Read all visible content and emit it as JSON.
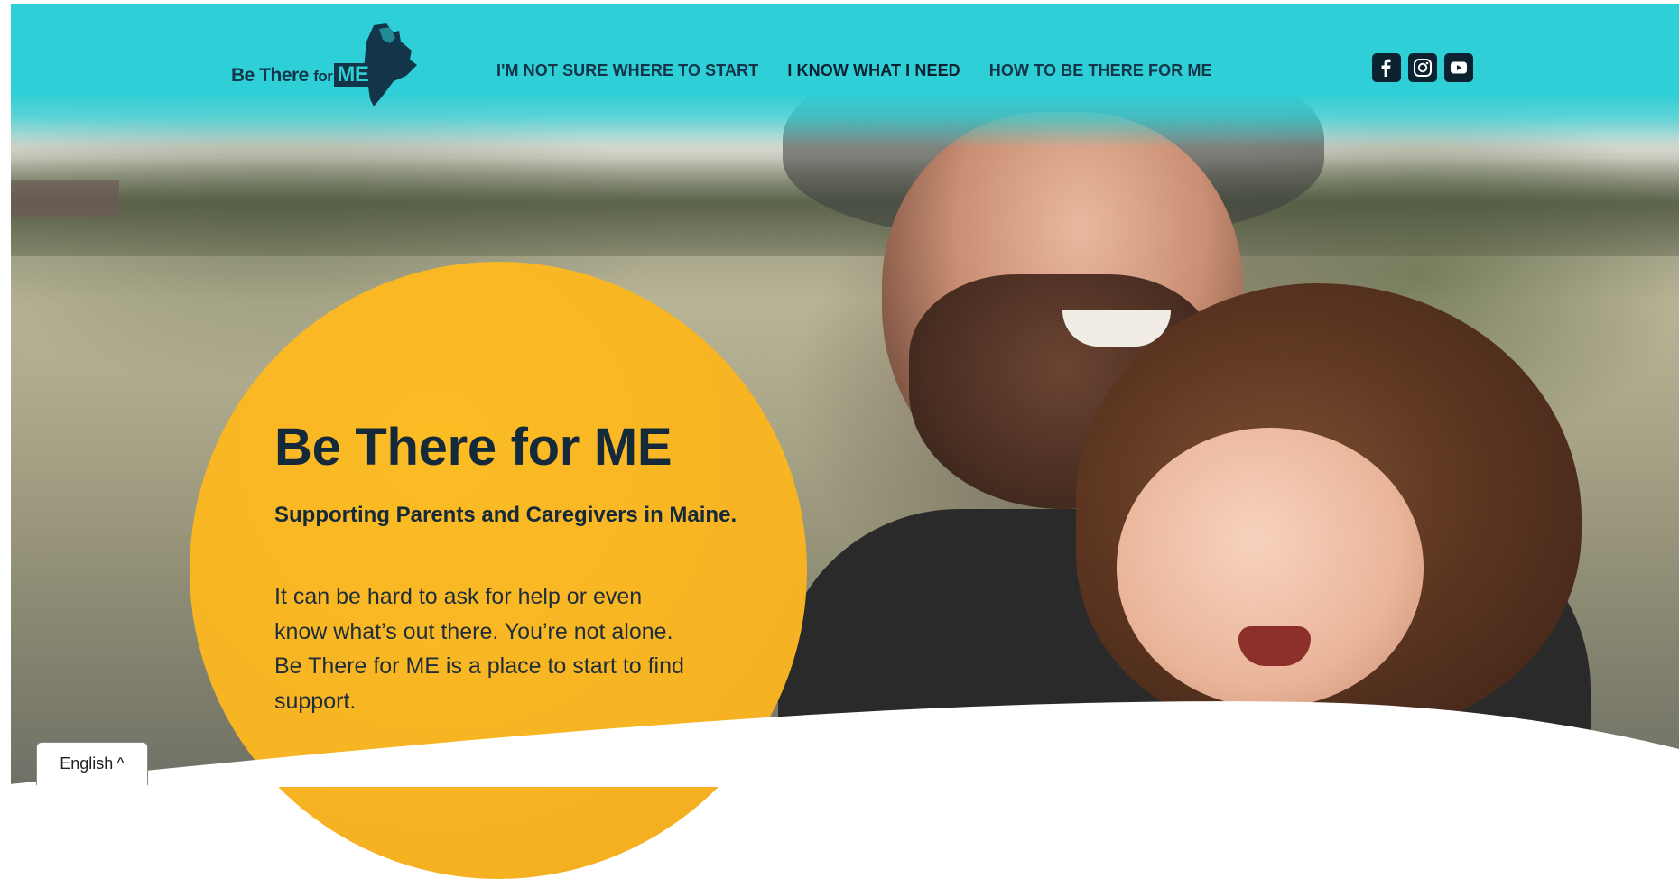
{
  "header": {
    "logo_text_main": "Be There",
    "logo_text_for": "for",
    "logo_text_me": "ME",
    "nav": [
      {
        "label": "I'M NOT SURE WHERE TO START"
      },
      {
        "label": "I KNOW WHAT I NEED"
      },
      {
        "label": "HOW TO BE THERE FOR ME"
      }
    ],
    "social": [
      {
        "icon": "facebook-icon"
      },
      {
        "icon": "instagram-icon"
      },
      {
        "icon": "youtube-icon"
      }
    ]
  },
  "hero": {
    "title": "Be There for ME",
    "subtitle": "Supporting Parents and Caregivers in Maine.",
    "body": "It can be hard to ask for help or even know what’s out there. You’re not alone. Be There for ME is a place to start to find support."
  },
  "language": {
    "label": "English",
    "caret": "^"
  },
  "colors": {
    "teal": "#2ecfd6",
    "navy": "#123549",
    "yellow": "#f7b423",
    "white": "#ffffff"
  }
}
